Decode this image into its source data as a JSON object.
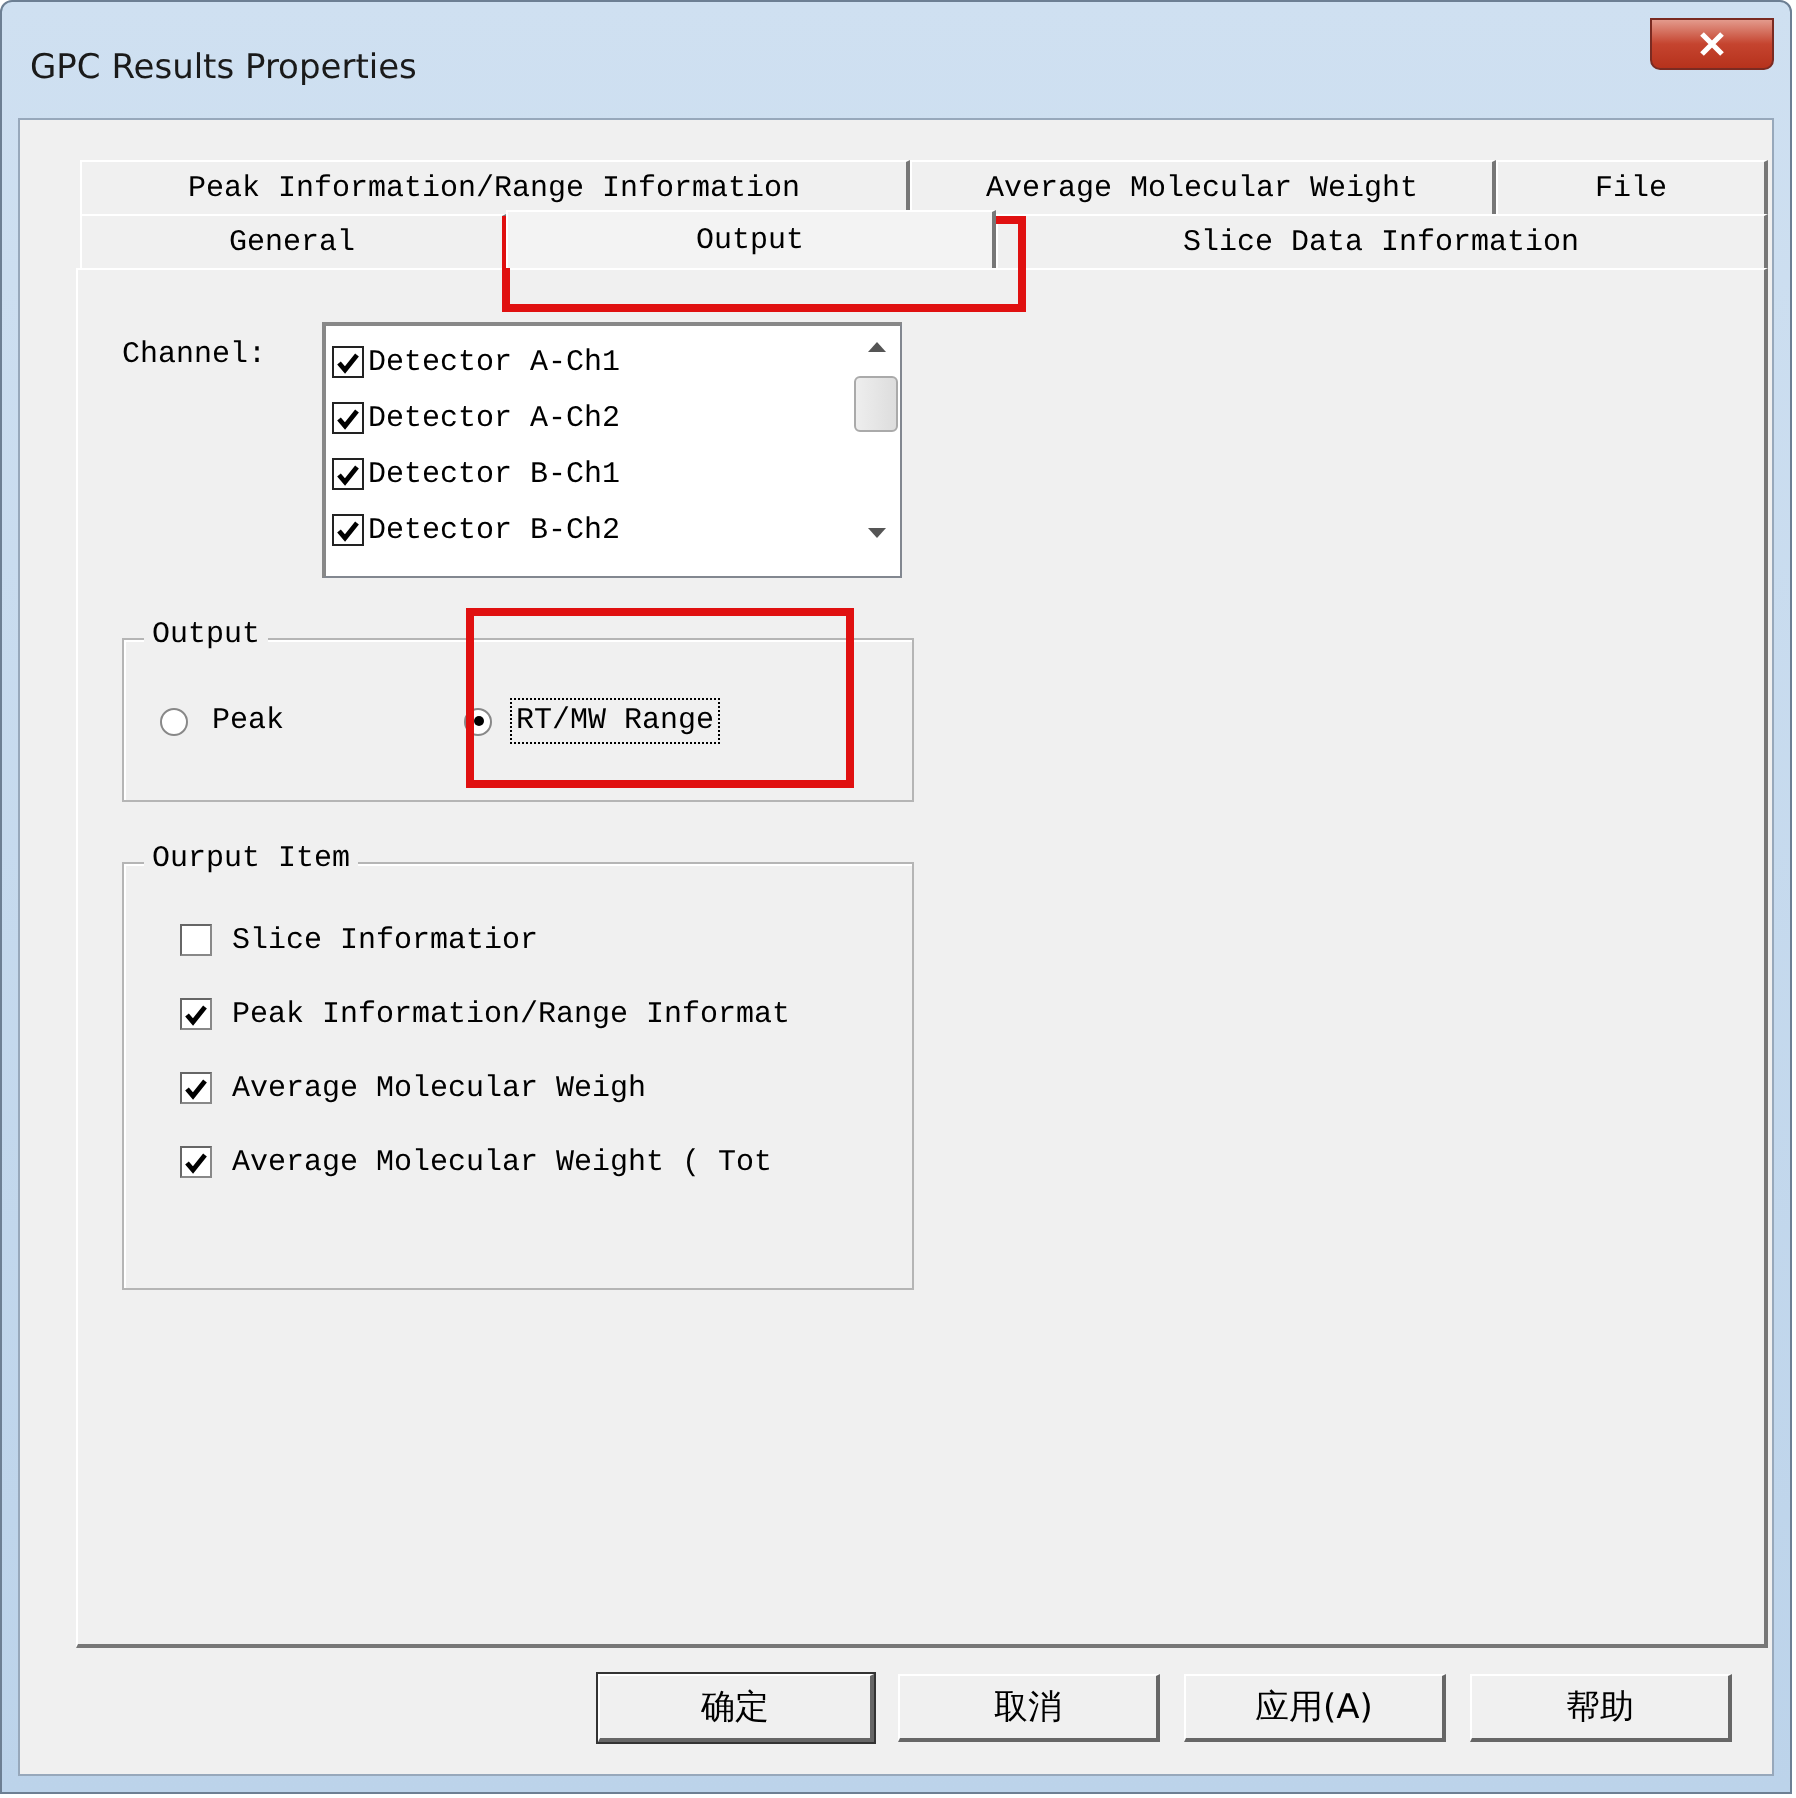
{
  "window": {
    "title": "GPC Results Properties"
  },
  "tab_rows": [
    {
      "tabs": [
        {
          "label": "Peak Information/Range Information",
          "selected": false
        },
        {
          "label": "Average Molecular Weight",
          "selected": false
        },
        {
          "label": "File",
          "selected": false
        }
      ]
    },
    {
      "tabs": [
        {
          "label": "General",
          "selected": false
        },
        {
          "label": "Output",
          "selected": true
        },
        {
          "label": "Slice Data Information",
          "selected": false
        }
      ]
    }
  ],
  "channel": {
    "label": "Channel:",
    "items": [
      {
        "label": "Detector A-Ch1",
        "checked": true
      },
      {
        "label": "Detector A-Ch2",
        "checked": true
      },
      {
        "label": "Detector B-Ch1",
        "checked": true
      },
      {
        "label": "Detector B-Ch2",
        "checked": true
      }
    ]
  },
  "output": {
    "title": "Output",
    "options": [
      {
        "label": "Peak",
        "selected": false
      },
      {
        "label": "RT/MW Range",
        "selected": true
      }
    ]
  },
  "output_item": {
    "title": "Ourput Item",
    "items": [
      {
        "label": "Slice Informatior",
        "checked": false
      },
      {
        "label": "Peak Information/Range Informat",
        "checked": true
      },
      {
        "label": "Average Molecular Weigh",
        "checked": true
      },
      {
        "label": "Average Molecular Weight ( Tot",
        "checked": true
      }
    ]
  },
  "buttons": [
    {
      "label": "确定",
      "default": true
    },
    {
      "label": "取消",
      "default": false
    },
    {
      "label": "应用(A)",
      "default": false
    },
    {
      "label": "帮助",
      "default": false
    }
  ]
}
